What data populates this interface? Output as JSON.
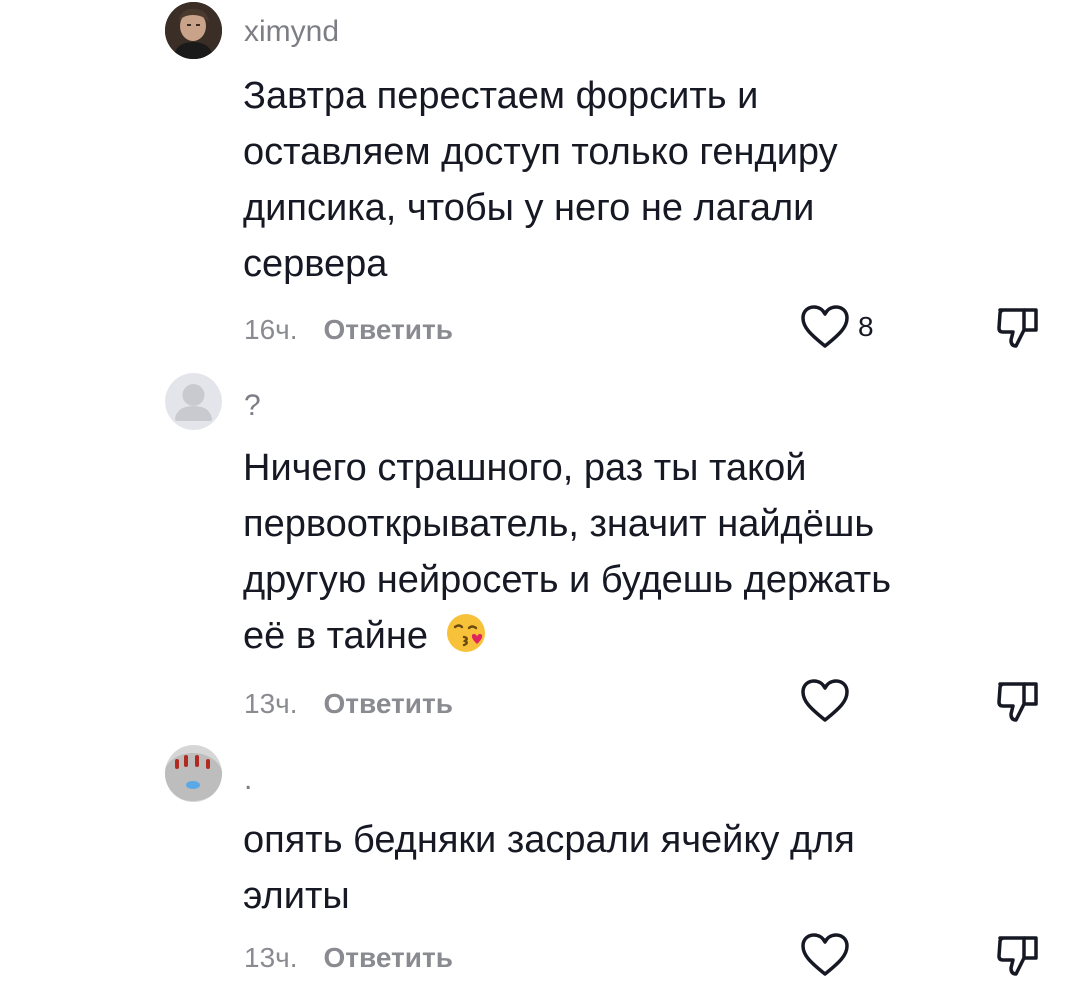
{
  "comments": [
    {
      "username": "ximynd",
      "text": "Завтра перестаем форсить и оставляем доступ только гендиру дипсика, чтобы у него не лагали сервера",
      "time": "16ч.",
      "reply_label": "Ответить",
      "likes": "8",
      "avatar": "photo-avatar"
    },
    {
      "username": "?",
      "text": "Ничего страшного, раз ты такой первооткрыватель, значит найдёшь другую нейросеть и будешь держать её в тайне",
      "emoji": "kissing-face-emoji",
      "time": "13ч.",
      "reply_label": "Ответить",
      "likes": "",
      "avatar": "default-avatar"
    },
    {
      "username": ".",
      "text": "опять бедняки засрали ячейку для элиты",
      "time": "13ч.",
      "reply_label": "Ответить",
      "likes": "",
      "avatar": "photo-avatar"
    }
  ],
  "colors": {
    "text": "#161823",
    "secondary": "#8a8b91",
    "username": "#7d7e85",
    "background": "#ffffff"
  },
  "icons": {
    "like": "heart-outline-icon",
    "dislike": "thumbs-down-icon"
  }
}
